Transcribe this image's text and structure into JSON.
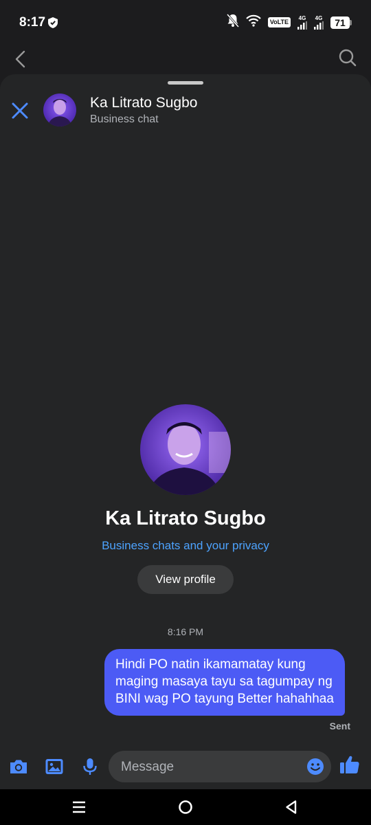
{
  "status_bar": {
    "time": "8:17",
    "volte": "VoLTE",
    "net1": "4G",
    "net2": "4G",
    "battery": "71"
  },
  "chat": {
    "title": "Ka Litrato Sugbo",
    "subtitle": "Business chat"
  },
  "profile": {
    "name": "Ka Litrato Sugbo",
    "privacy_link": "Business chats and your privacy",
    "view_profile_label": "View profile"
  },
  "messages": [
    {
      "timestamp": "8:16 PM",
      "text": "Hindi PO natin ikamamatay kung maging masaya tayu sa tagumpay ng BINI wag PO tayung Better hahahhaa",
      "status": "Sent"
    }
  ],
  "composer": {
    "placeholder": "Message"
  },
  "colors": {
    "accent": "#4c5bf5",
    "link": "#4da3ff",
    "icon_blue": "#4d8bff"
  }
}
